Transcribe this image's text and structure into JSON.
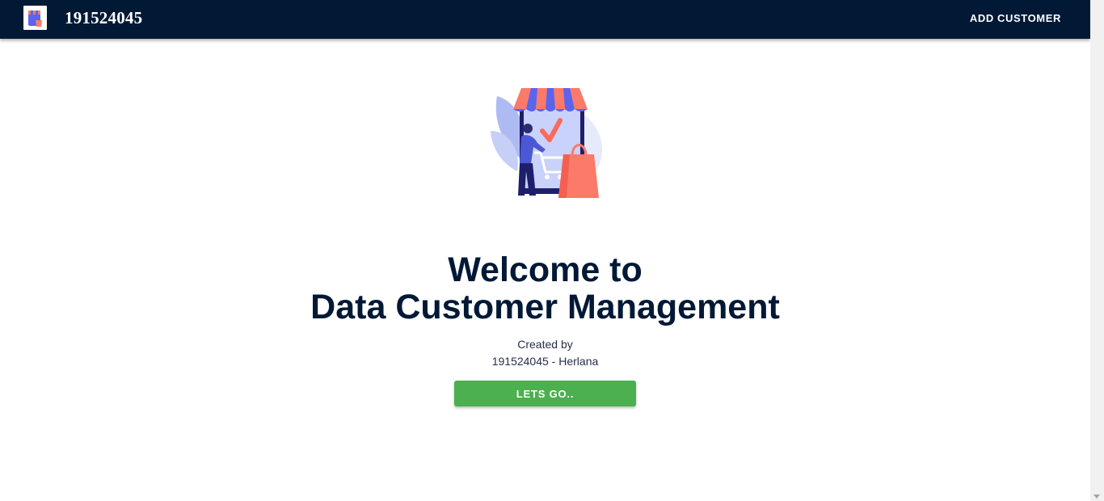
{
  "header": {
    "brand": "191524045",
    "nav_button": "ADD CUSTOMER",
    "logo_icon": "shop-logo-icon"
  },
  "hero": {
    "illustration": "online-shop-illustration",
    "title_line1": "Welcome to",
    "title_line2": "Data Customer Management",
    "created_label": "Created by",
    "author": "191524045 - Herlana",
    "cta_label": "LETS GO.."
  },
  "colors": {
    "appbar": "#011935",
    "title": "#011935",
    "cta": "#4caf50",
    "awning_red": "#fb7a6a",
    "awning_blue": "#5b64ef"
  }
}
